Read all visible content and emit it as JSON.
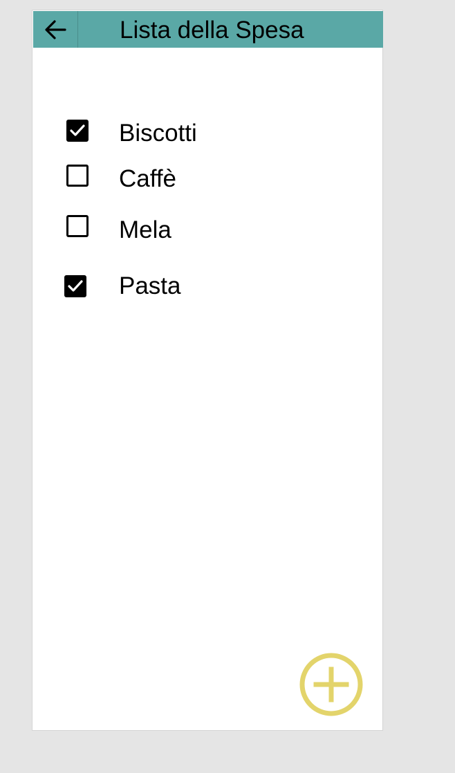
{
  "header": {
    "title": "Lista della Spesa",
    "back_icon": "arrow-left-icon",
    "color": "#5aa8a6"
  },
  "items": [
    {
      "label": "Biscotti",
      "checked": true
    },
    {
      "label": "Caffè",
      "checked": false
    },
    {
      "label": "Mela",
      "checked": false
    },
    {
      "label": "Pasta",
      "checked": true
    }
  ],
  "fab": {
    "icon": "plus-circle-icon",
    "color": "#e3d46b"
  }
}
